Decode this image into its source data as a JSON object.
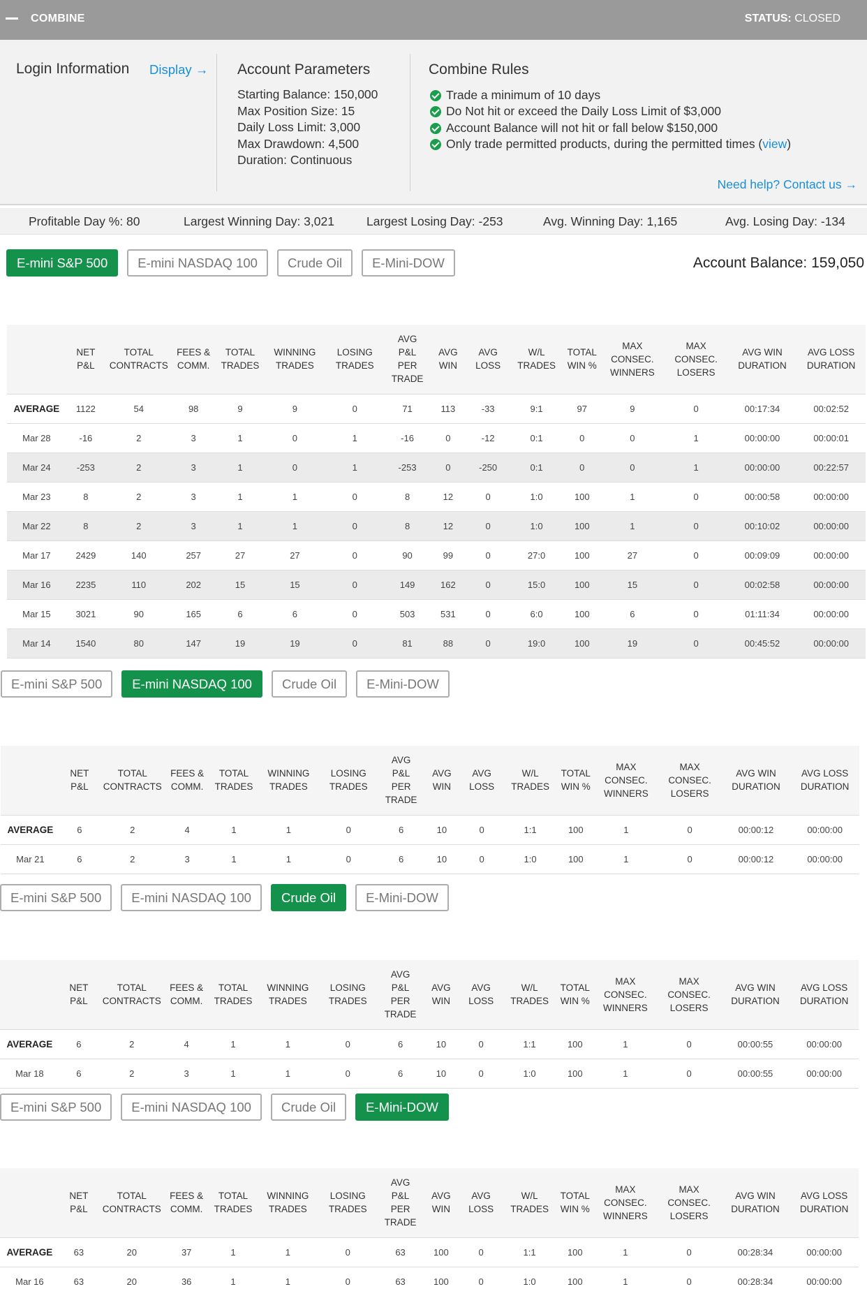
{
  "header": {
    "title": "COMBINE",
    "status_label": "STATUS:",
    "status_value": "CLOSED"
  },
  "login": {
    "title": "Login Information",
    "display_link": "Display →"
  },
  "account_parameters": {
    "title": "Account Parameters",
    "items": [
      "Starting Balance: 150,000",
      "Max Position Size: 15",
      "Daily Loss Limit: 3,000",
      "Max Drawdown: 4,500",
      "Duration: Continuous"
    ]
  },
  "combine_rules": {
    "title": "Combine Rules",
    "rule1": "Trade a minimum of 10 days",
    "rule2": "Do Not hit or exceed the Daily Loss Limit of $3,000",
    "rule3": "Account Balance will not hit or fall below $150,000",
    "rule4_prefix": "Only trade permitted products, during the permitted times (",
    "rule4_link": "view",
    "rule4_suffix": ")",
    "help_link": "Need help? Contact us →"
  },
  "stats": {
    "profitable_day": "Profitable Day %: 80",
    "largest_winning": "Largest Winning Day: 3,021",
    "largest_losing": "Largest Losing Day: -253",
    "avg_winning": "Avg. Winning Day: 1,165",
    "avg_losing": "Avg. Losing Day: -134"
  },
  "account_balance": "Account Balance: 159,050",
  "products": [
    "E-mini S&P 500",
    "E-mini NASDAQ 100",
    "Crude Oil",
    "E-Mini-DOW"
  ],
  "columns": [
    "NET P&L",
    "TOTAL CONTRACTS",
    "FEES & COMM.",
    "TOTAL TRADES",
    "WINNING TRADES",
    "LOSING TRADES",
    "AVG P&L PER TRADE",
    "AVG WIN",
    "AVG LOSS",
    "W/L TRADES",
    "TOTAL WIN %",
    "MAX CONSEC. WINNERS",
    "MAX CONSEC. LOSERS",
    "AVG WIN DURATION",
    "AVG LOSS DURATION"
  ],
  "tables": [
    {
      "product": "E-mini S&P 500",
      "rows": [
        [
          "AVERAGE",
          "1122",
          "54",
          "98",
          "9",
          "9",
          "0",
          "71",
          "113",
          "-33",
          "9:1",
          "97",
          "9",
          "0",
          "00:17:34",
          "00:02:52"
        ],
        [
          "Mar 28",
          "-16",
          "2",
          "3",
          "1",
          "0",
          "1",
          "-16",
          "0",
          "-12",
          "0:1",
          "0",
          "0",
          "1",
          "00:00:00",
          "00:00:01"
        ],
        [
          "Mar 24",
          "-253",
          "2",
          "3",
          "1",
          "0",
          "1",
          "-253",
          "0",
          "-250",
          "0:1",
          "0",
          "0",
          "1",
          "00:00:00",
          "00:22:57"
        ],
        [
          "Mar 23",
          "8",
          "2",
          "3",
          "1",
          "1",
          "0",
          "8",
          "12",
          "0",
          "1:0",
          "100",
          "1",
          "0",
          "00:00:58",
          "00:00:00"
        ],
        [
          "Mar 22",
          "8",
          "2",
          "3",
          "1",
          "1",
          "0",
          "8",
          "12",
          "0",
          "1:0",
          "100",
          "1",
          "0",
          "00:10:02",
          "00:00:00"
        ],
        [
          "Mar 17",
          "2429",
          "140",
          "257",
          "27",
          "27",
          "0",
          "90",
          "99",
          "0",
          "27:0",
          "100",
          "27",
          "0",
          "00:09:09",
          "00:00:00"
        ],
        [
          "Mar 16",
          "2235",
          "110",
          "202",
          "15",
          "15",
          "0",
          "149",
          "162",
          "0",
          "15:0",
          "100",
          "15",
          "0",
          "00:02:58",
          "00:00:00"
        ],
        [
          "Mar 15",
          "3021",
          "90",
          "165",
          "6",
          "6",
          "0",
          "503",
          "531",
          "0",
          "6:0",
          "100",
          "6",
          "0",
          "01:11:34",
          "00:00:00"
        ],
        [
          "Mar 14",
          "1540",
          "80",
          "147",
          "19",
          "19",
          "0",
          "81",
          "88",
          "0",
          "19:0",
          "100",
          "19",
          "0",
          "00:45:52",
          "00:00:00"
        ]
      ]
    },
    {
      "product": "E-mini NASDAQ 100",
      "rows": [
        [
          "AVERAGE",
          "6",
          "2",
          "4",
          "1",
          "1",
          "0",
          "6",
          "10",
          "0",
          "1:1",
          "100",
          "1",
          "0",
          "00:00:12",
          "00:00:00"
        ],
        [
          "Mar 21",
          "6",
          "2",
          "3",
          "1",
          "1",
          "0",
          "6",
          "10",
          "0",
          "1:0",
          "100",
          "1",
          "0",
          "00:00:12",
          "00:00:00"
        ]
      ]
    },
    {
      "product": "Crude Oil",
      "rows": [
        [
          "AVERAGE",
          "6",
          "2",
          "4",
          "1",
          "1",
          "0",
          "6",
          "10",
          "0",
          "1:1",
          "100",
          "1",
          "0",
          "00:00:55",
          "00:00:00"
        ],
        [
          "Mar 18",
          "6",
          "2",
          "3",
          "1",
          "1",
          "0",
          "6",
          "10",
          "0",
          "1:0",
          "100",
          "1",
          "0",
          "00:00:55",
          "00:00:00"
        ]
      ]
    },
    {
      "product": "E-Mini-DOW",
      "rows": [
        [
          "AVERAGE",
          "63",
          "20",
          "37",
          "1",
          "1",
          "0",
          "63",
          "100",
          "0",
          "1:1",
          "100",
          "1",
          "0",
          "00:28:34",
          "00:00:00"
        ],
        [
          "Mar 16",
          "63",
          "20",
          "36",
          "1",
          "1",
          "0",
          "63",
          "100",
          "0",
          "1:0",
          "100",
          "1",
          "0",
          "00:28:34",
          "00:00:00"
        ]
      ]
    }
  ],
  "colors": {
    "accent_green": "#14914a",
    "link_blue": "#1a8fd6",
    "header_gray": "#9a9a9a"
  }
}
